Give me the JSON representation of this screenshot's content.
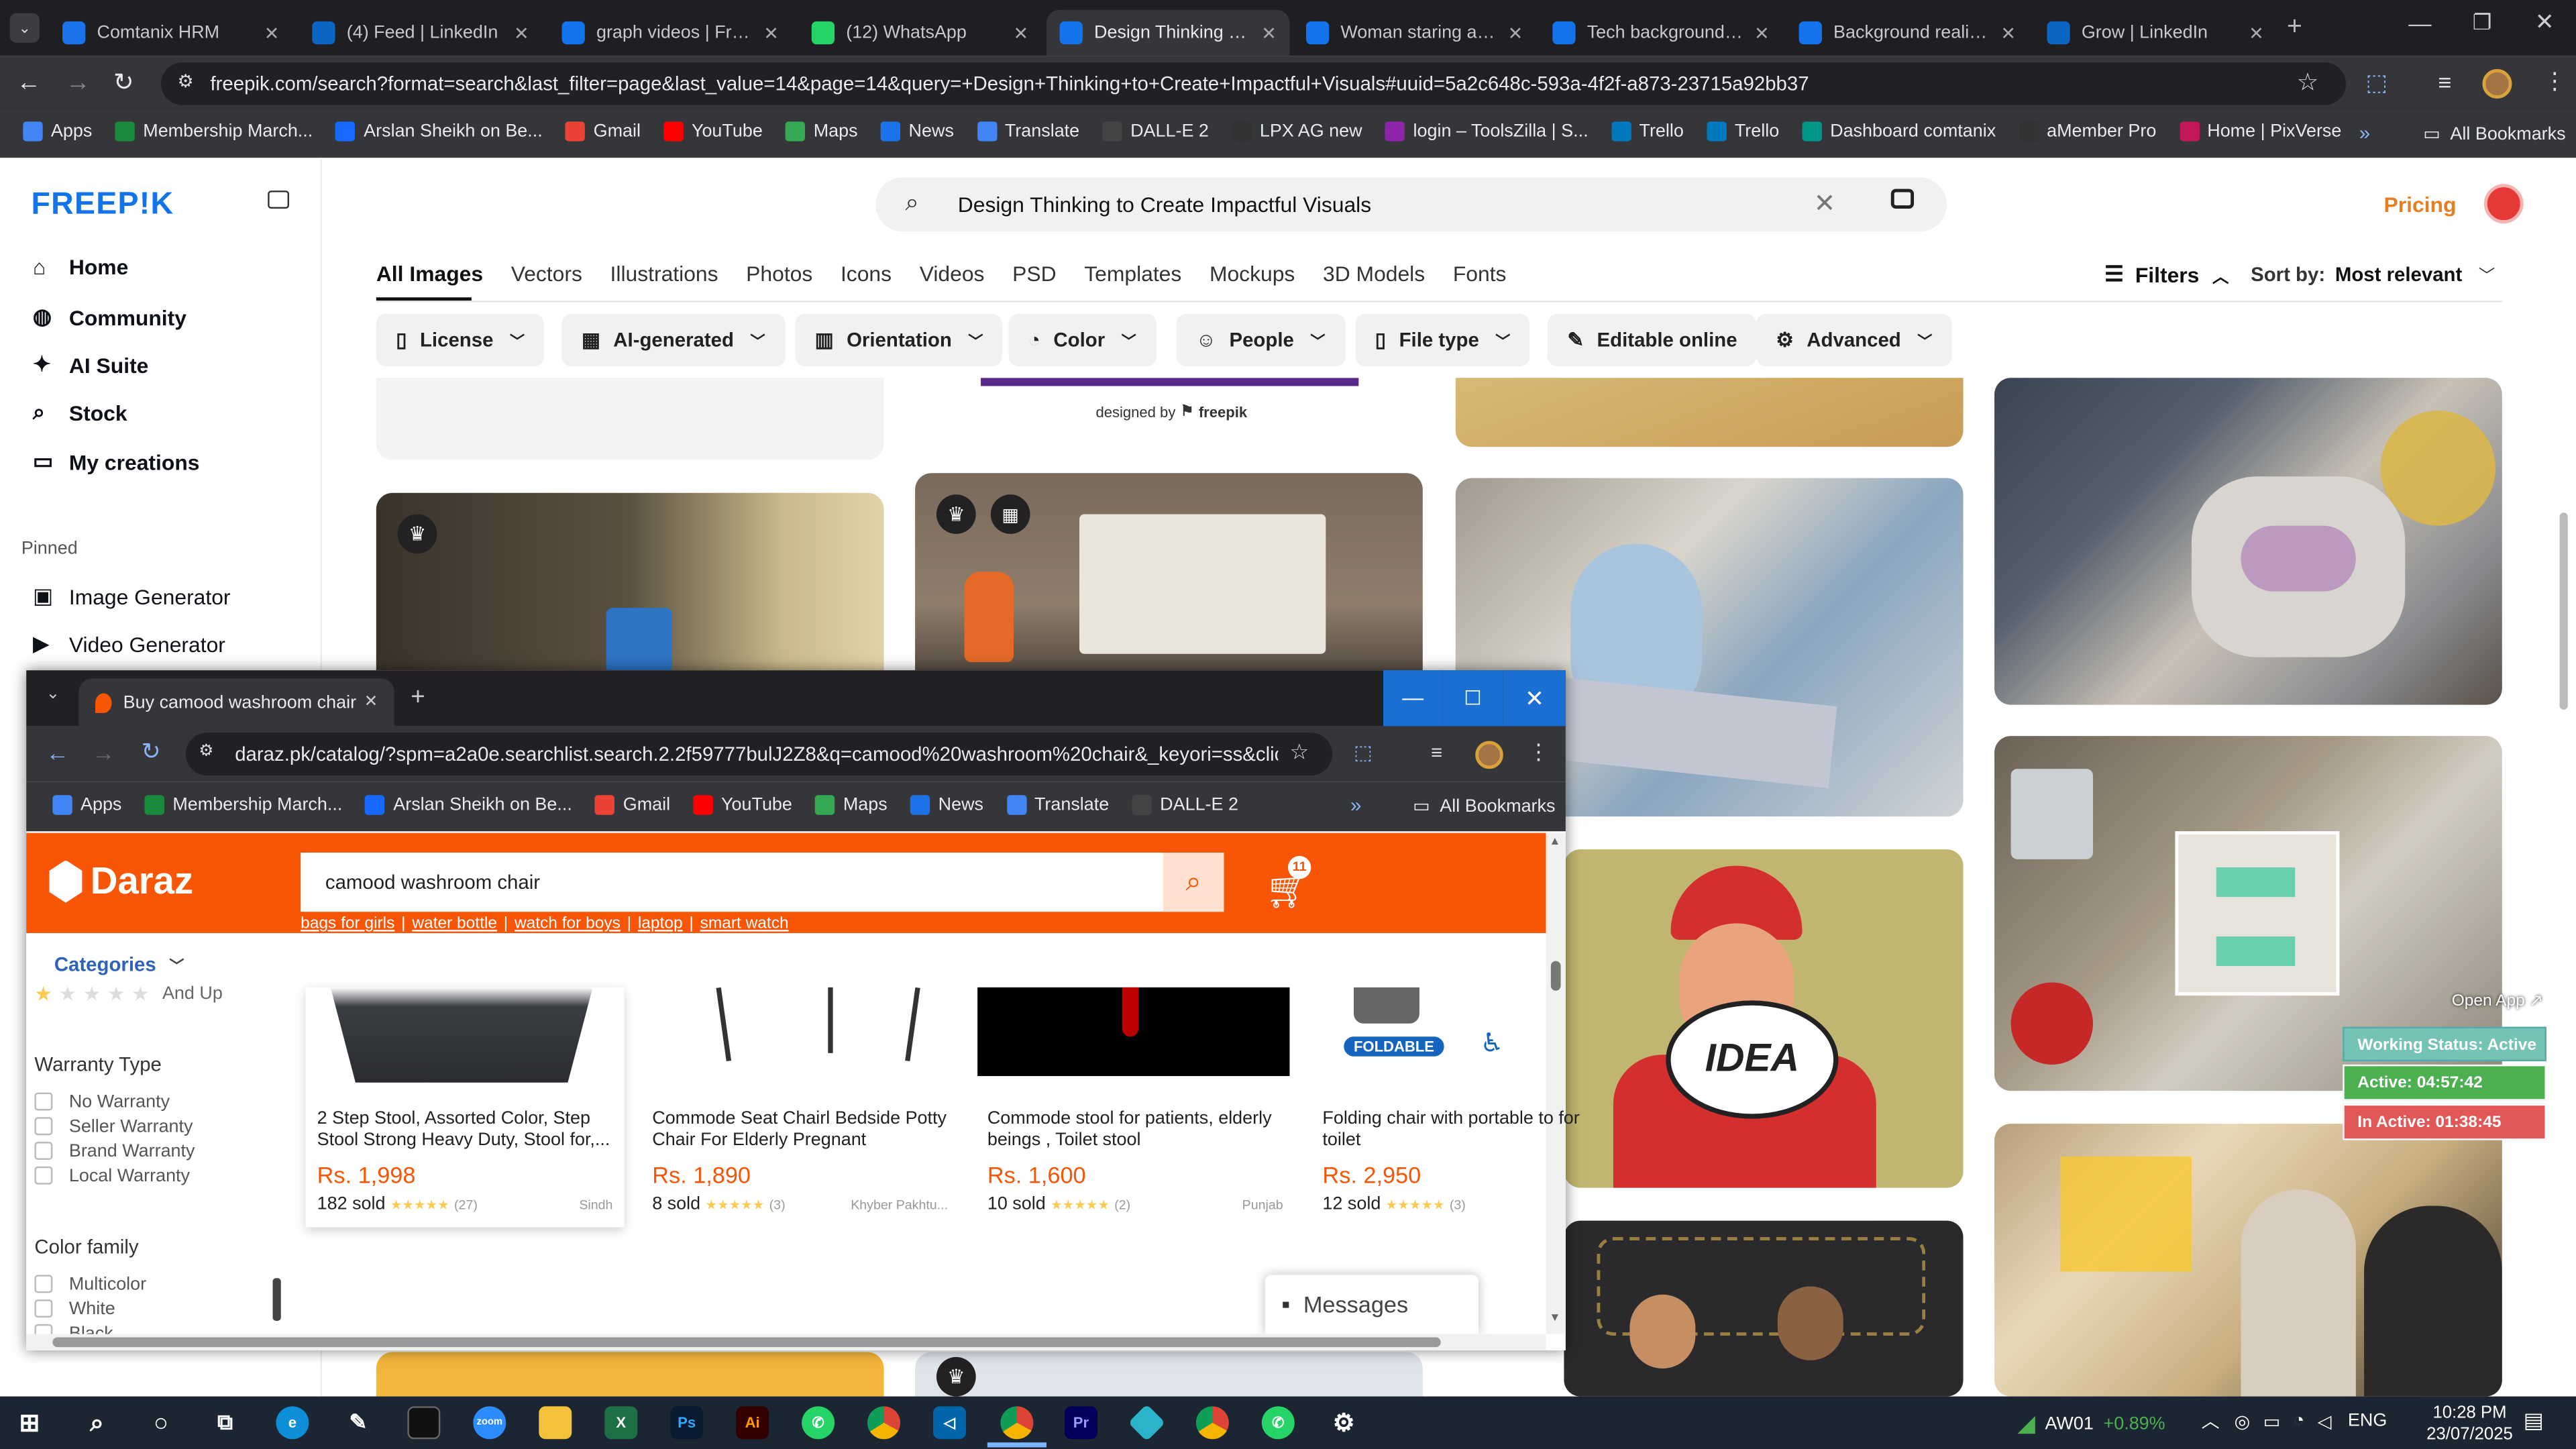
{
  "browser": {
    "tabs": [
      {
        "title": "Comtanix HRM",
        "color": "#1a73e8"
      },
      {
        "title": "(4) Feed | LinkedIn",
        "color": "#0a66c2"
      },
      {
        "title": "graph videos | Freepik",
        "color": "#1273eb"
      },
      {
        "title": "(12) WhatsApp",
        "color": "#25d366"
      },
      {
        "title": "Design Thinking to Create",
        "color": "#1273eb"
      },
      {
        "title": "Woman staring at a lap",
        "color": "#1273eb"
      },
      {
        "title": "Tech background vec",
        "color": "#1273eb"
      },
      {
        "title": "Background realistic",
        "color": "#1273eb"
      },
      {
        "title": "Grow | LinkedIn",
        "color": "#0a66c2"
      }
    ],
    "url": "freepik.com/search?format=search&last_filter=page&last_value=14&page=14&query=+Design+Thinking+to+Create+Impactful+Visuals#uuid=5a2c648c-593a-4f2f-a873-23715a92bb37",
    "bookmarks": [
      "Apps",
      "Membership March...",
      "Arslan Sheikh on Be...",
      "Gmail",
      "YouTube",
      "Maps",
      "News",
      "Translate",
      "DALL-E 2",
      "LPX AG new",
      "login – ToolsZilla | S...",
      "Trello",
      "Trello",
      "Dashboard comtanix",
      "aMember Pro",
      "Home | PixVerse"
    ],
    "all_bookmarks": "All Bookmarks"
  },
  "freepik": {
    "logo": "FREEP!K",
    "nav": [
      "Home",
      "Community",
      "AI Suite",
      "Stock",
      "My creations"
    ],
    "pinned_label": "Pinned",
    "pinned": [
      "Image Generator",
      "Video Generator"
    ],
    "search_query": "Design Thinking to Create Impactful Visuals",
    "pricing": "Pricing",
    "categories": [
      "All Images",
      "Vectors",
      "Illustrations",
      "Photos",
      "Icons",
      "Videos",
      "PSD",
      "Templates",
      "Mockups",
      "3D Models",
      "Fonts"
    ],
    "filters_label": "Filters",
    "sort_label": "Sort by:",
    "sort_value": "Most relevant",
    "chips": [
      "License",
      "AI-generated",
      "Orientation",
      "Color",
      "People",
      "File type",
      "Editable online",
      "Advanced"
    ],
    "designed_by": "designed by",
    "designed_brand": "freepik",
    "idea_text": "IDEA"
  },
  "widget": {
    "open_app": "Open App ↗",
    "status": "Working Status: Active",
    "active": "Active: 04:57:42",
    "inactive": "In Active: 01:38:45"
  },
  "daraz_window": {
    "tab_title": "Buy camood washroom chair O",
    "url": "daraz.pk/catalog/?spm=a2a0e.searchlist.search.2.2f59777bulJ2Z8&q=camood%20washroom%20chair&_keyori=ss&clickTra...",
    "bookmarks": [
      "Apps",
      "Membership March...",
      "Arslan Sheikh on Be...",
      "Gmail",
      "YouTube",
      "Maps",
      "News",
      "Translate",
      "DALL-E 2"
    ],
    "all_bookmarks": "All Bookmarks",
    "logo": "Daraz",
    "search_value": "camood washroom chair",
    "cart_count": "11",
    "suggestions": [
      "bags for girls",
      "water bottle",
      "watch for boys",
      "laptop",
      "smart watch"
    ],
    "categories_label": "Categories",
    "and_up": "And Up",
    "warranty_title": "Warranty Type",
    "warranty": [
      "No Warranty",
      "Seller Warranty",
      "Brand Warranty",
      "Local Warranty"
    ],
    "color_title": "Color family",
    "colors": [
      "Multicolor",
      "White",
      "Black"
    ],
    "foldable": "FOLDABLE",
    "messages": "Messages",
    "products": [
      {
        "name": "2 Step Stool, Assorted Color, Step Stool Strong Heavy Duty, Stool for,...",
        "price": "Rs. 1,998",
        "sold": "182 sold",
        "reviews": "(27)",
        "location": "Sindh"
      },
      {
        "name": "Commode Seat Chairl Bedside Potty Chair For Elderly Pregnant Women...",
        "price": "Rs. 1,890",
        "sold": "8 sold",
        "reviews": "(3)",
        "location": "Khyber Pakhtu..."
      },
      {
        "name": "Commode stool for patients, elderly beings , Toilet stool",
        "price": "Rs. 1,600",
        "sold": "10 sold",
        "reviews": "(2)",
        "location": "Punjab"
      },
      {
        "name": "Folding chair with portable to for toilet",
        "price": "Rs. 2,950",
        "sold": "12 sold",
        "reviews": "(3)",
        "location": ""
      }
    ]
  },
  "taskbar": {
    "stock_name": "AW01",
    "stock_change": "+0.89%",
    "lang": "ENG",
    "time": "10:28 PM",
    "date": "23/07/2025"
  }
}
